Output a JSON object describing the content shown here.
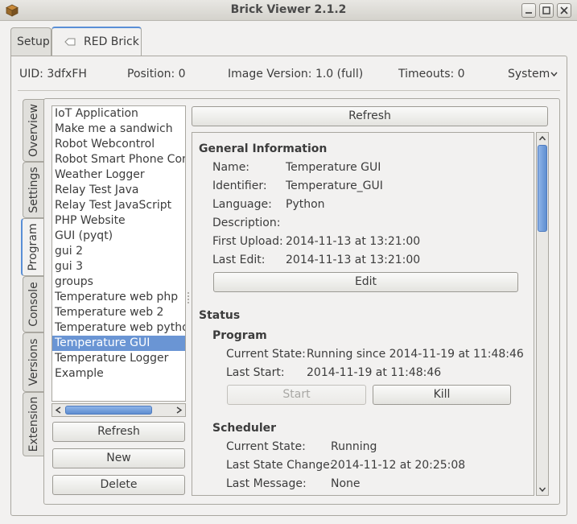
{
  "window": {
    "title": "Brick Viewer 2.1.2"
  },
  "top_tabs": [
    {
      "label": "Setup"
    },
    {
      "label": "RED Brick"
    }
  ],
  "info_bar": {
    "uid": "UID:  3dfxFH",
    "position": "Position:  0",
    "image_version": "Image Version:  1.0 (full)",
    "timeouts": "Timeouts:  0",
    "system_menu": "System"
  },
  "side_tabs": [
    {
      "label": "Overview"
    },
    {
      "label": "Settings"
    },
    {
      "label": "Program"
    },
    {
      "label": "Console"
    },
    {
      "label": "Versions"
    },
    {
      "label": "Extension"
    }
  ],
  "programs": [
    "IoT Application",
    "Make me a sandwich",
    "Robot Webcontrol",
    "Robot Smart Phone Control",
    "Weather Logger",
    "Relay Test Java",
    "Relay Test JavaScript",
    "PHP Website",
    "GUI (pyqt)",
    "gui 2",
    "gui 3",
    "groups",
    "Temperature web php",
    "Temperature web 2",
    "Temperature web python",
    "Temperature GUI",
    "Temperature Logger",
    "Example"
  ],
  "selected_program": "Temperature GUI",
  "list_buttons": {
    "refresh": "Refresh",
    "new": "New",
    "delete": "Delete"
  },
  "top_refresh": "Refresh",
  "general": {
    "heading": "General Information",
    "name_label": "Name:",
    "name_value": "Temperature GUI",
    "identifier_label": "Identifier:",
    "identifier_value": "Temperature_GUI",
    "language_label": "Language:",
    "language_value": "Python",
    "description_label": "Description:",
    "description_value": "",
    "first_upload_label": "First Upload:",
    "first_upload_value": "2014-11-13 at 13:21:00",
    "last_edit_label": "Last Edit:",
    "last_edit_value": "2014-11-13 at 13:21:00",
    "edit_button": "Edit"
  },
  "status": {
    "heading": "Status",
    "program_heading": "Program",
    "current_state_label": "Current State:",
    "current_state_value": "Running since 2014-11-19 at 11:48:46",
    "last_start_label": "Last Start:",
    "last_start_value": "2014-11-19 at 11:48:46",
    "start_button": "Start",
    "kill_button": "Kill",
    "scheduler_heading": "Scheduler",
    "sched_state_label": "Current State:",
    "sched_state_value": "Running",
    "sched_change_label": "Last State Change:",
    "sched_change_value": "2014-11-12 at 20:25:08",
    "sched_msg_label": "Last Message:",
    "sched_msg_value": "None"
  }
}
